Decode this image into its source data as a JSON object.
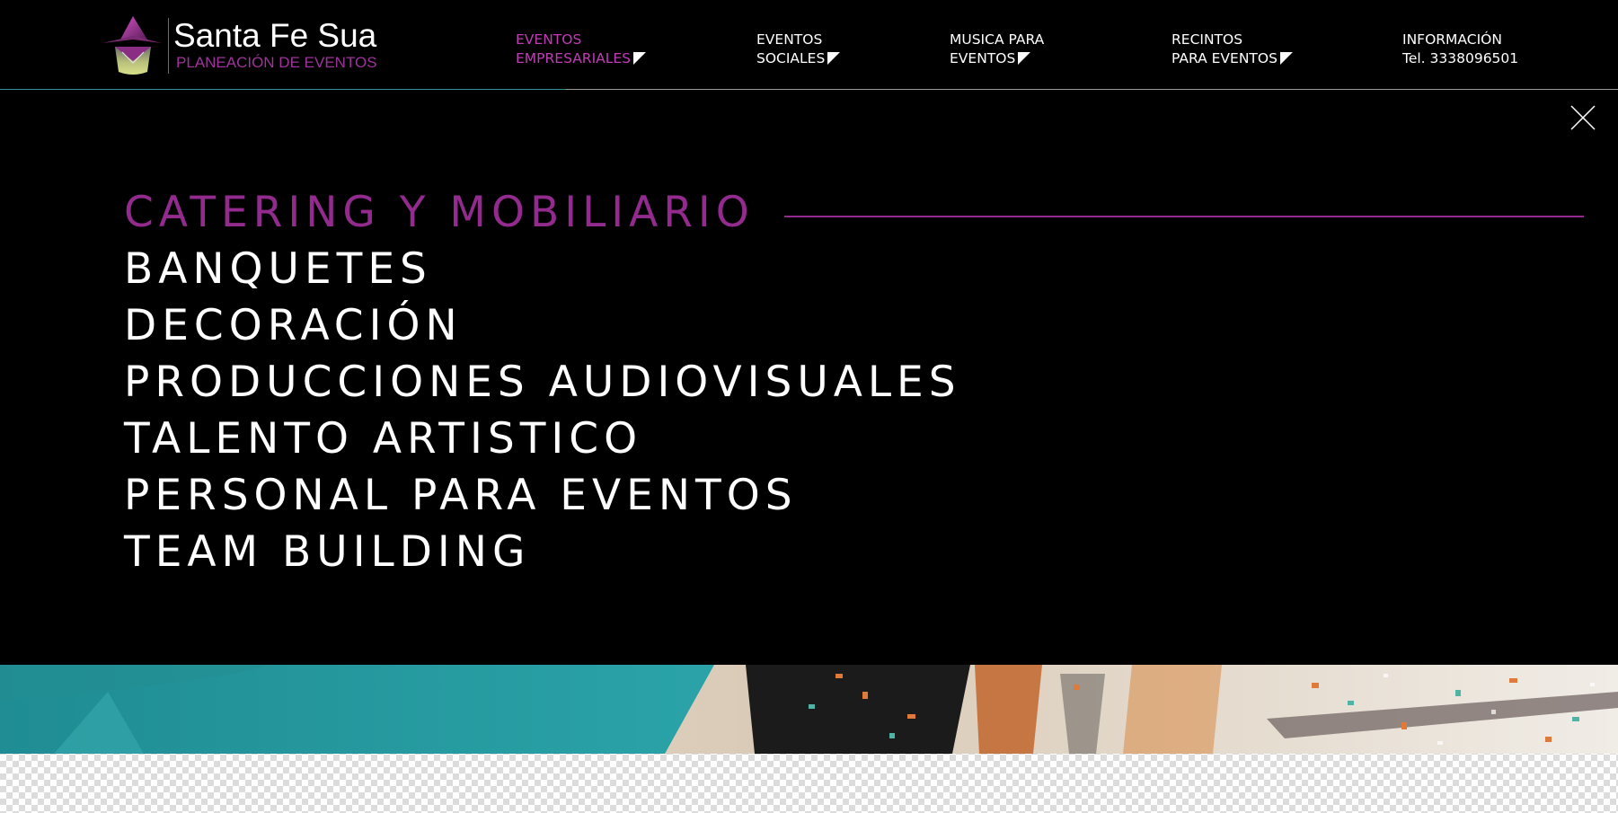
{
  "brand": {
    "name": "Santa Fe Sua",
    "tagline": "PLANEACIÓN DE EVENTOS",
    "accent_color": "#932b8e"
  },
  "nav": {
    "items": [
      {
        "line1": "EVENTOS",
        "line2": "EMPRESARIALES",
        "has_dropdown": true,
        "active": true
      },
      {
        "line1": "EVENTOS",
        "line2": "SOCIALES",
        "has_dropdown": true,
        "active": false
      },
      {
        "line1": "MUSICA PARA",
        "line2": "EVENTOS",
        "has_dropdown": true,
        "active": false
      },
      {
        "line1": "RECINTOS",
        "line2": "PARA EVENTOS",
        "has_dropdown": true,
        "active": false
      },
      {
        "line1": "INFORMACIÓN",
        "line2": "Tel. 3338096501",
        "has_dropdown": false,
        "active": false
      }
    ]
  },
  "menu": {
    "close_icon": "close-icon",
    "items": [
      {
        "label": "CATERING Y MOBILIARIO",
        "active": true
      },
      {
        "label": "BANQUETES",
        "active": false
      },
      {
        "label": "DECORACIÓN",
        "active": false
      },
      {
        "label": "PRODUCCIONES AUDIOVISUALES",
        "active": false
      },
      {
        "label": "TALENTO ARTISTICO",
        "active": false
      },
      {
        "label": "PERSONAL PARA EVENTOS",
        "active": false
      },
      {
        "label": "TEAM BUILDING",
        "active": false
      }
    ]
  },
  "colors": {
    "background": "#000000",
    "active_nav": "#c13bb6",
    "active_menu": "#932b8e",
    "text": "#ffffff"
  }
}
